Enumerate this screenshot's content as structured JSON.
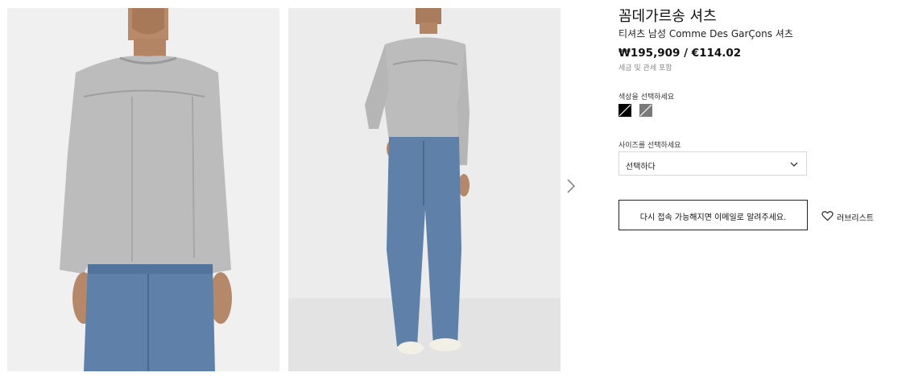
{
  "product": {
    "brand": "꼼데가르송 셔츠",
    "subtitle": "티셔츠 남성 Comme Des GarÇons 셔츠",
    "price": "₩195,909 / €114.02",
    "tax_note": "세금 및 관세 포함"
  },
  "gallery": {
    "photos": [
      {
        "name": "photo-closeup",
        "alt": "close-up"
      },
      {
        "name": "photo-full-body",
        "alt": "full body"
      }
    ],
    "next_icon": "chevron-right-icon"
  },
  "color": {
    "label": "색상을 선택하세요",
    "swatches": [
      {
        "name": "black",
        "color": "#000000"
      },
      {
        "name": "grey",
        "color": "#7a7a7a"
      }
    ]
  },
  "size": {
    "label": "사이즈를 선택하세요",
    "selected": "선택하다",
    "icon": "chevron-down-icon"
  },
  "actions": {
    "notify_label": "다시 접속 가능해지면 이메일로 알려주세요.",
    "wishlist_label": "러브리스트",
    "wishlist_icon": "heart-icon"
  },
  "colors": {
    "text": "#111111",
    "muted": "#888888",
    "border": "#d8d8d8",
    "shirt_grey": "#b9b9b9",
    "denim": "#5e7fa6"
  }
}
